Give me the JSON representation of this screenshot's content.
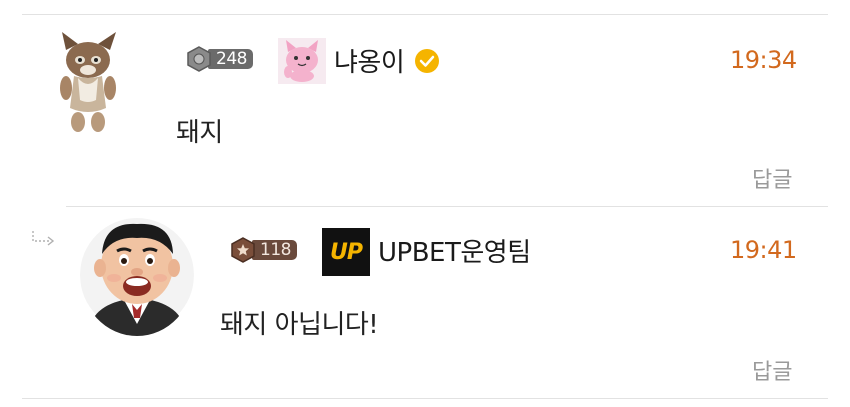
{
  "comments": [
    {
      "level": "248",
      "nickname": "냐옹이",
      "verified": true,
      "time": "19:34",
      "text": "돼지",
      "reply_label": "답글",
      "avatar": "cat-avatar",
      "user_icon": "pink-cat-icon"
    },
    {
      "level": "118",
      "nickname": "UPBET운영팀",
      "time": "19:41",
      "text": "돼지 아닙니다!",
      "reply_label": "답글",
      "avatar": "cartoon-boy-avatar",
      "user_icon": "up-logo-icon",
      "logo_text": "UP",
      "is_reply": true
    }
  ],
  "colors": {
    "time": "#d2691e",
    "verified": "#f5b400",
    "divider": "#e2e2e2"
  }
}
